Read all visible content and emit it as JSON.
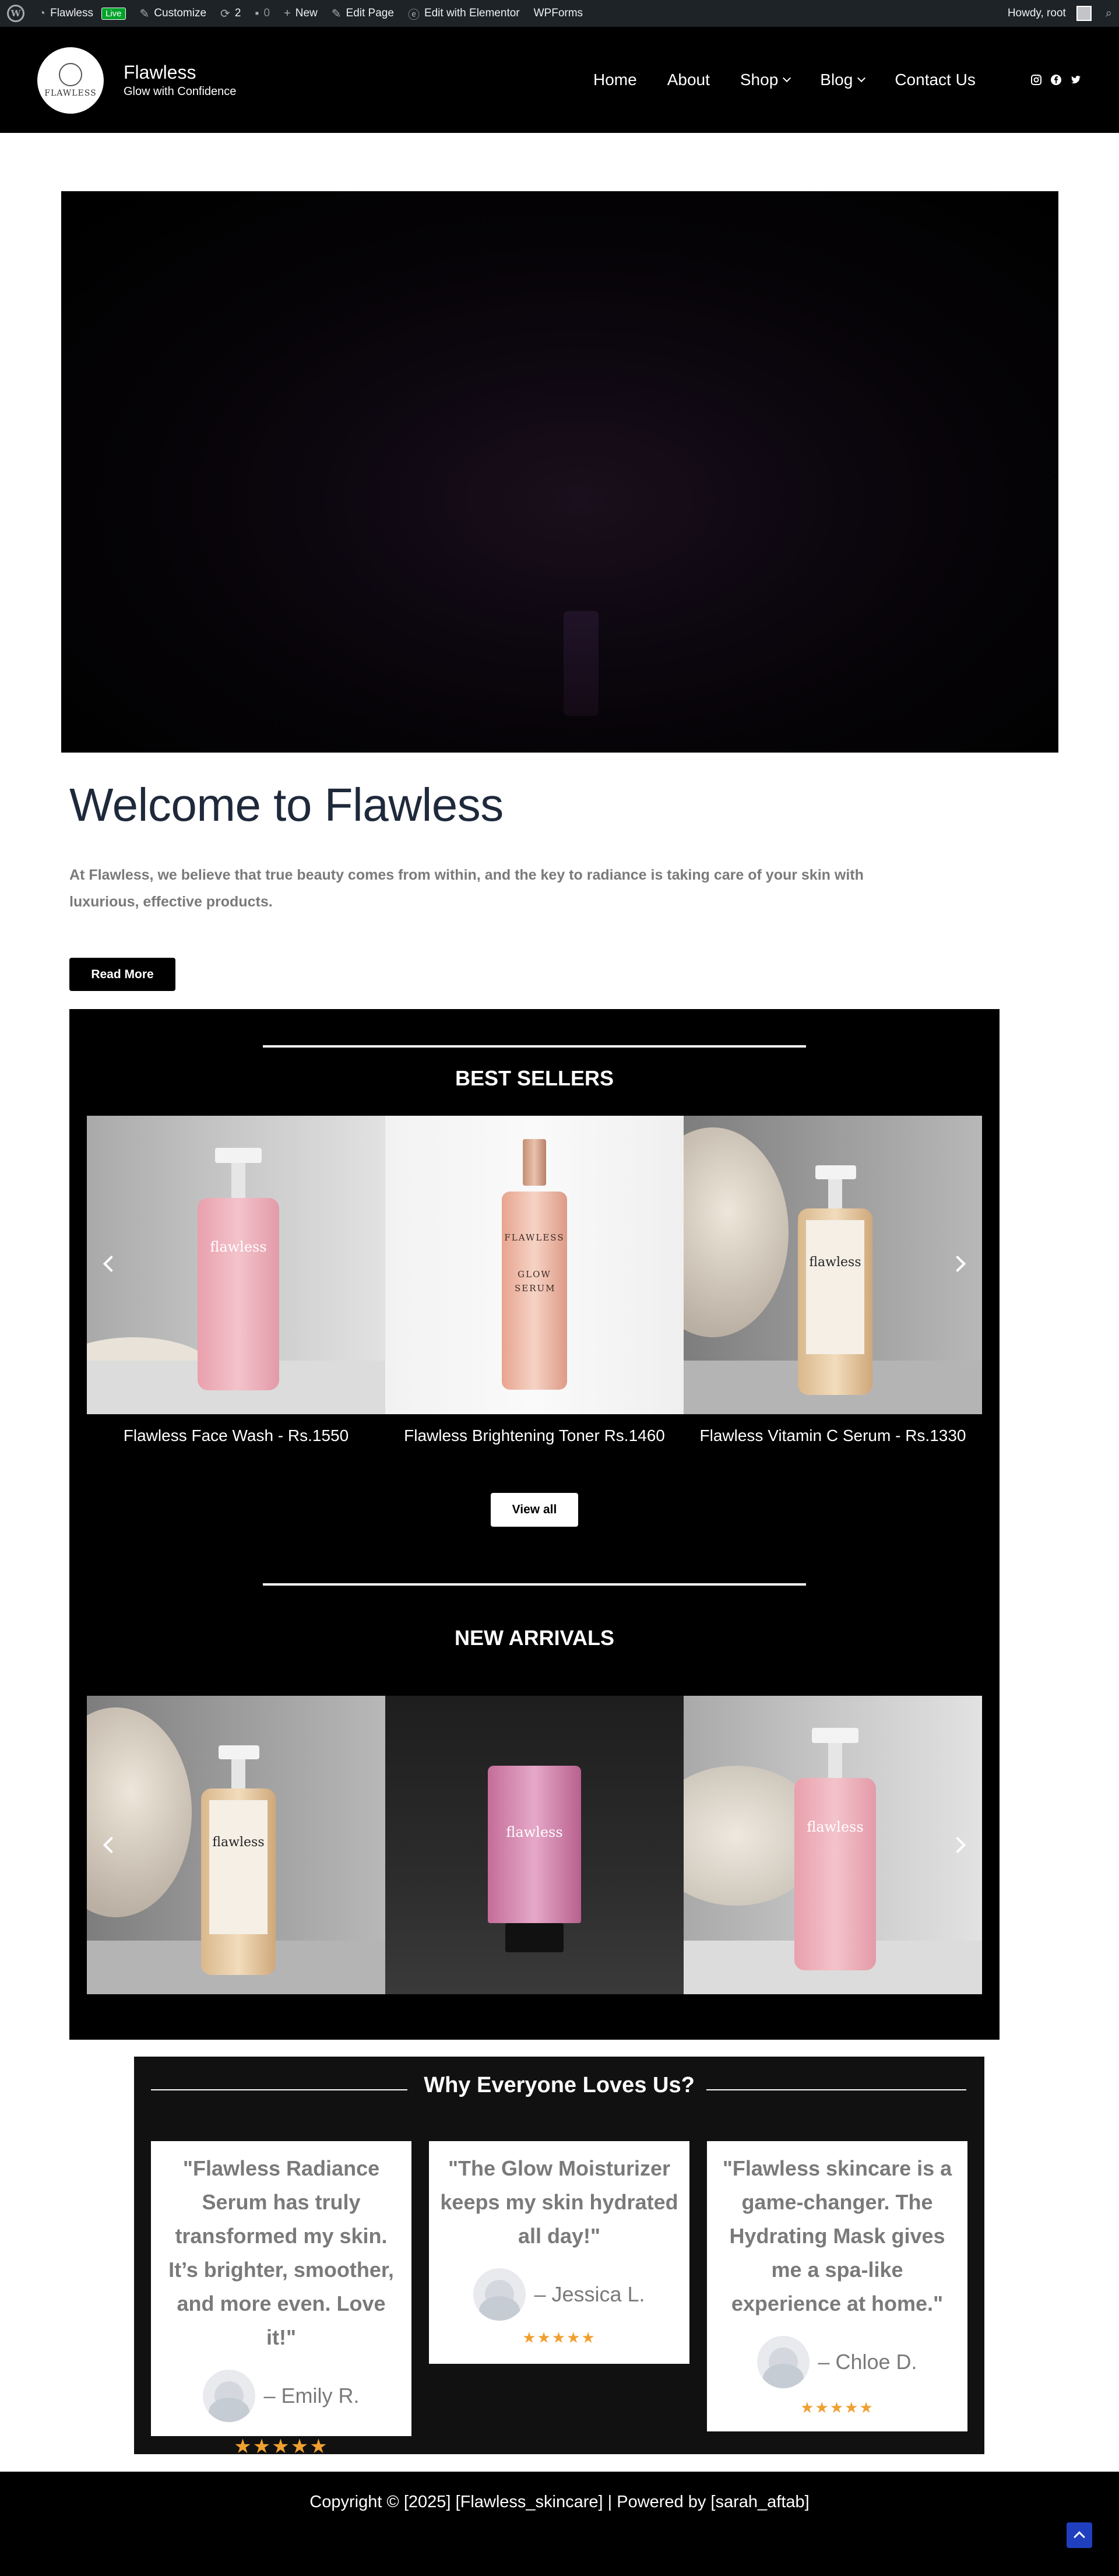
{
  "admin_bar": {
    "site_name": "Flawless",
    "live_badge": "Live",
    "customize": "Customize",
    "updates_count": "2",
    "comments_count": "0",
    "new_label": "New",
    "edit_page": "Edit Page",
    "edit_elementor": "Edit with Elementor",
    "wpforms": "WPForms",
    "howdy": "Howdy, root"
  },
  "header": {
    "logo_text": "FLAWLESS",
    "site_title": "Flawless",
    "tagline": "Glow with Confidence",
    "nav": [
      {
        "label": "Home"
      },
      {
        "label": "About"
      },
      {
        "label": "Shop"
      },
      {
        "label": "Blog"
      },
      {
        "label": "Contact Us"
      }
    ],
    "socials": [
      "instagram-icon",
      "facebook-icon",
      "twitter-icon"
    ]
  },
  "hero": {
    "title": "Welcome to Flawless",
    "text": "At Flawless, we believe that true beauty comes from within, and the key to radiance is taking care of your skin with luxurious, effective products.",
    "button": "Read More"
  },
  "best_sellers": {
    "title": "BEST SELLERS",
    "products": [
      {
        "caption": "Flawless Face Wash - Rs.1550",
        "bottle_label": "flawless"
      },
      {
        "caption": "Flawless Brightening Toner Rs.1460",
        "bottle_label": "FLAWLESS",
        "bottle_sub": "GLOW SERUM"
      },
      {
        "caption": "Flawless Vitamin C Serum - Rs.1330",
        "bottle_label": "flawless"
      }
    ],
    "view_all": "View all"
  },
  "new_arrivals": {
    "title": "NEW ARRIVALS",
    "products": [
      {
        "bottle_label": "flawless"
      },
      {
        "bottle_label": "flawless"
      },
      {
        "bottle_label": "flawless"
      }
    ]
  },
  "testimonials": {
    "title": "Why Everyone Loves Us?",
    "items": [
      {
        "quote": "\"Flawless Radiance Serum has truly transformed my skin. It’s brighter, smoother, and more even. Love it!\"",
        "author": "– Emily R.",
        "stars": "★★★★★"
      },
      {
        "quote": "\"The Glow Moisturizer keeps my skin hydrated all day!\"",
        "author": "– Jessica L.",
        "stars": "★★★★★"
      },
      {
        "quote": "\"Flawless skincare is a game-changer. The Hydrating Mask gives me a spa-like experience at home.\"",
        "author": "– Chloe D.",
        "stars": "★★★★★"
      }
    ]
  },
  "footer": {
    "text": "Copyright © [2025] [Flawless_skincare] | Powered by [sarah_aftab]"
  },
  "colors": {
    "admin_bar": "#1d2327",
    "live_green": "#00a32a",
    "header_bg": "#000000",
    "heading": "#1e293b",
    "body_text": "#7a7a7a",
    "star": "#f0a030",
    "to_top": "#1f3fbf"
  }
}
